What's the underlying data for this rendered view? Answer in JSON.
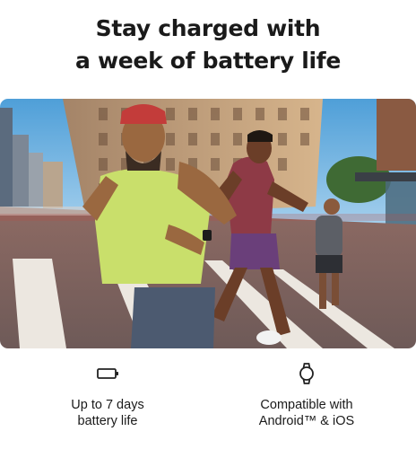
{
  "headline": {
    "line1": "Stay charged with",
    "line2": "a week of battery life"
  },
  "hero": {
    "description": ""
  },
  "features": [
    {
      "icon": "battery-icon",
      "line1": "Up to 7 days",
      "line2": "battery life"
    },
    {
      "icon": "smartwatch-icon",
      "line1": "Compatible with",
      "line2": "Android™ & iOS"
    }
  ],
  "colors": {
    "text": "#1a1a1a",
    "background": "#ffffff"
  }
}
